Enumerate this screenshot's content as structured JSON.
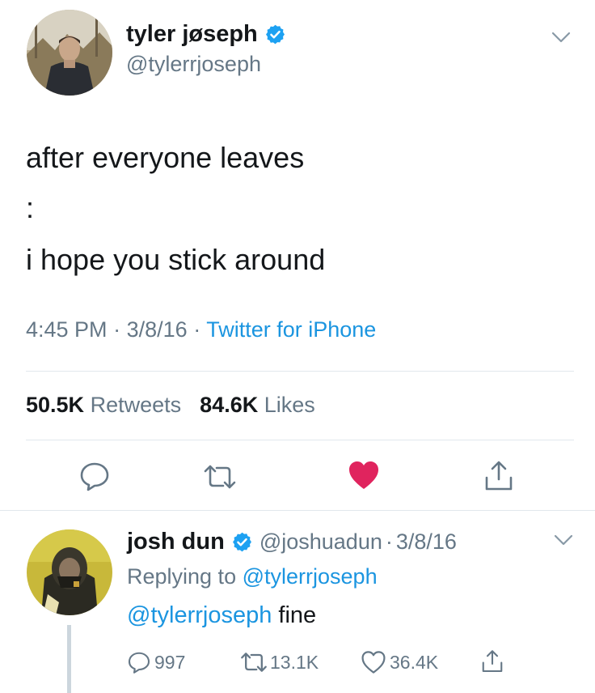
{
  "main_tweet": {
    "author_name": "tyler jøseph",
    "handle": "@tylerrjoseph",
    "text_lines": [
      "after everyone leaves",
      ":",
      "i hope you stick around"
    ],
    "time": "4:45 PM",
    "sep1": "·",
    "date": "3/8/16",
    "sep2": "·",
    "source": "Twitter for iPhone",
    "retweets_count": "50.5K",
    "retweets_label": "Retweets",
    "likes_count": "84.6K",
    "likes_label": "Likes"
  },
  "reply": {
    "author_name": "josh dun",
    "handle": "@joshuadun",
    "sep": "·",
    "date": "3/8/16",
    "replying_prefix": "Replying to",
    "replying_to": "@tylerrjoseph",
    "mention": "@tylerrjoseph",
    "text": "fine",
    "reply_count": "997",
    "retweet_count": "13.1K",
    "like_count": "36.4K"
  },
  "colors": {
    "like_active": "#e0245e",
    "link": "#1b95e0",
    "verified": "#1da1f2",
    "muted": "#657786"
  },
  "icons": [
    "verified-badge-icon",
    "chevron-down-icon",
    "reply-icon",
    "retweet-icon",
    "heart-icon",
    "share-icon"
  ]
}
